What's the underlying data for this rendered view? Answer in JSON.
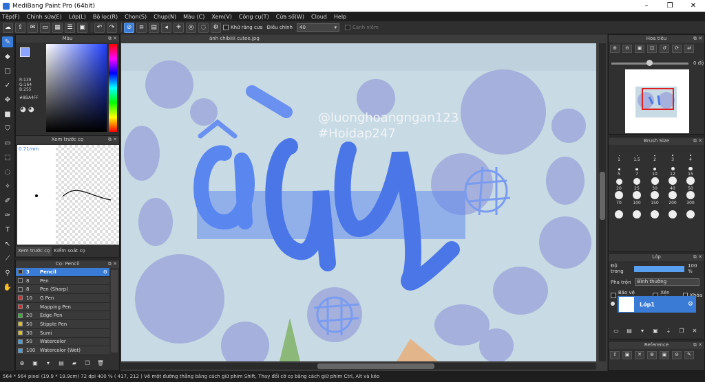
{
  "window": {
    "title": "MediBang Paint Pro (64bit)",
    "minimize": "–",
    "maximize": "❐",
    "close": "✕"
  },
  "menu": [
    "Tệp(F)",
    "Chỉnh sửa(E)",
    "Lớp(L)",
    "Bộ lọc(R)",
    "Chọn(S)",
    "Chụp(N)",
    "Màu (C)",
    "Xem(V)",
    "Công cụ(T)",
    "Cửa sổ(W)",
    "Cloud",
    "Help"
  ],
  "toolbar": {
    "antialias_label": "Khử răng cưa",
    "correction_label": "Điều chỉnh",
    "correction_value": "40",
    "snap_label": "Canh niềm"
  },
  "color_panel": {
    "title": "Màu",
    "r": "R:139",
    "g": "G:164",
    "b": "B:255",
    "hex": "#8BA4FF",
    "fg_color": "#8BA4FF"
  },
  "brush_preview": {
    "title": "Xem trước cọ",
    "size": "0.71mm",
    "tab1": "Xem trước cọ",
    "tab2": "Kiểm soát cọ"
  },
  "brush_list": {
    "title": "Cọ: Pencil",
    "items": [
      {
        "size": "3",
        "name": "Pencil",
        "color": "#333333"
      },
      {
        "size": "8",
        "name": "Pen",
        "color": "#333333"
      },
      {
        "size": "8",
        "name": "Pen (Sharp)",
        "color": "#333333"
      },
      {
        "size": "10",
        "name": "G Pen",
        "color": "#d03030"
      },
      {
        "size": "8",
        "name": "Mapping Pen",
        "color": "#d03030"
      },
      {
        "size": "20",
        "name": "Edge Pen",
        "color": "#30b030"
      },
      {
        "size": "50",
        "name": "Stipple Pen",
        "color": "#e0c020"
      },
      {
        "size": "30",
        "name": "Sumi",
        "color": "#e0c020"
      },
      {
        "size": "50",
        "name": "Watercolor",
        "color": "#40a0e0"
      },
      {
        "size": "100",
        "name": "Watercolor (Wet)",
        "color": "#40a0e0"
      }
    ]
  },
  "canvas": {
    "doc_name": "ảnh chibiiii cutee.jpg",
    "watermark1": "@luonghoangngan123",
    "watermark2": "#Hoidap247"
  },
  "navigator": {
    "title": "Hoa tiêu",
    "angle": "0 độ"
  },
  "brush_size": {
    "title": "Brush Size",
    "sizes": [
      "1",
      "1.5",
      "2",
      "3",
      "4",
      "5",
      "7",
      "10",
      "12",
      "15",
      "20",
      "25",
      "30",
      "40",
      "50",
      "70",
      "100",
      "150",
      "200",
      "300",
      "",
      "",
      "",
      "",
      ""
    ]
  },
  "layers": {
    "title": "Lớp",
    "opacity_label": "Độ trong",
    "opacity_value": "100 %",
    "opacity_fraction": 1.0,
    "blend_label": "Pha trộn",
    "blend_value": "Bình thường",
    "protect_alpha": "Bảo vệ alpha",
    "clipping": "Xén bớt",
    "lock": "Khóa",
    "layer_name": "Lớp1"
  },
  "reference": {
    "title": "Reference"
  },
  "status": {
    "text": "564 * 564 pixel   (19.9 * 19.9cm)   72 dpi   400 %   ( 417, 212 )   Vẽ một đường thẳng bằng cách giữ phím Shift, Thay đổi cỡ cọ bằng cách giữ phím Ctrl, Alt và kéo"
  }
}
